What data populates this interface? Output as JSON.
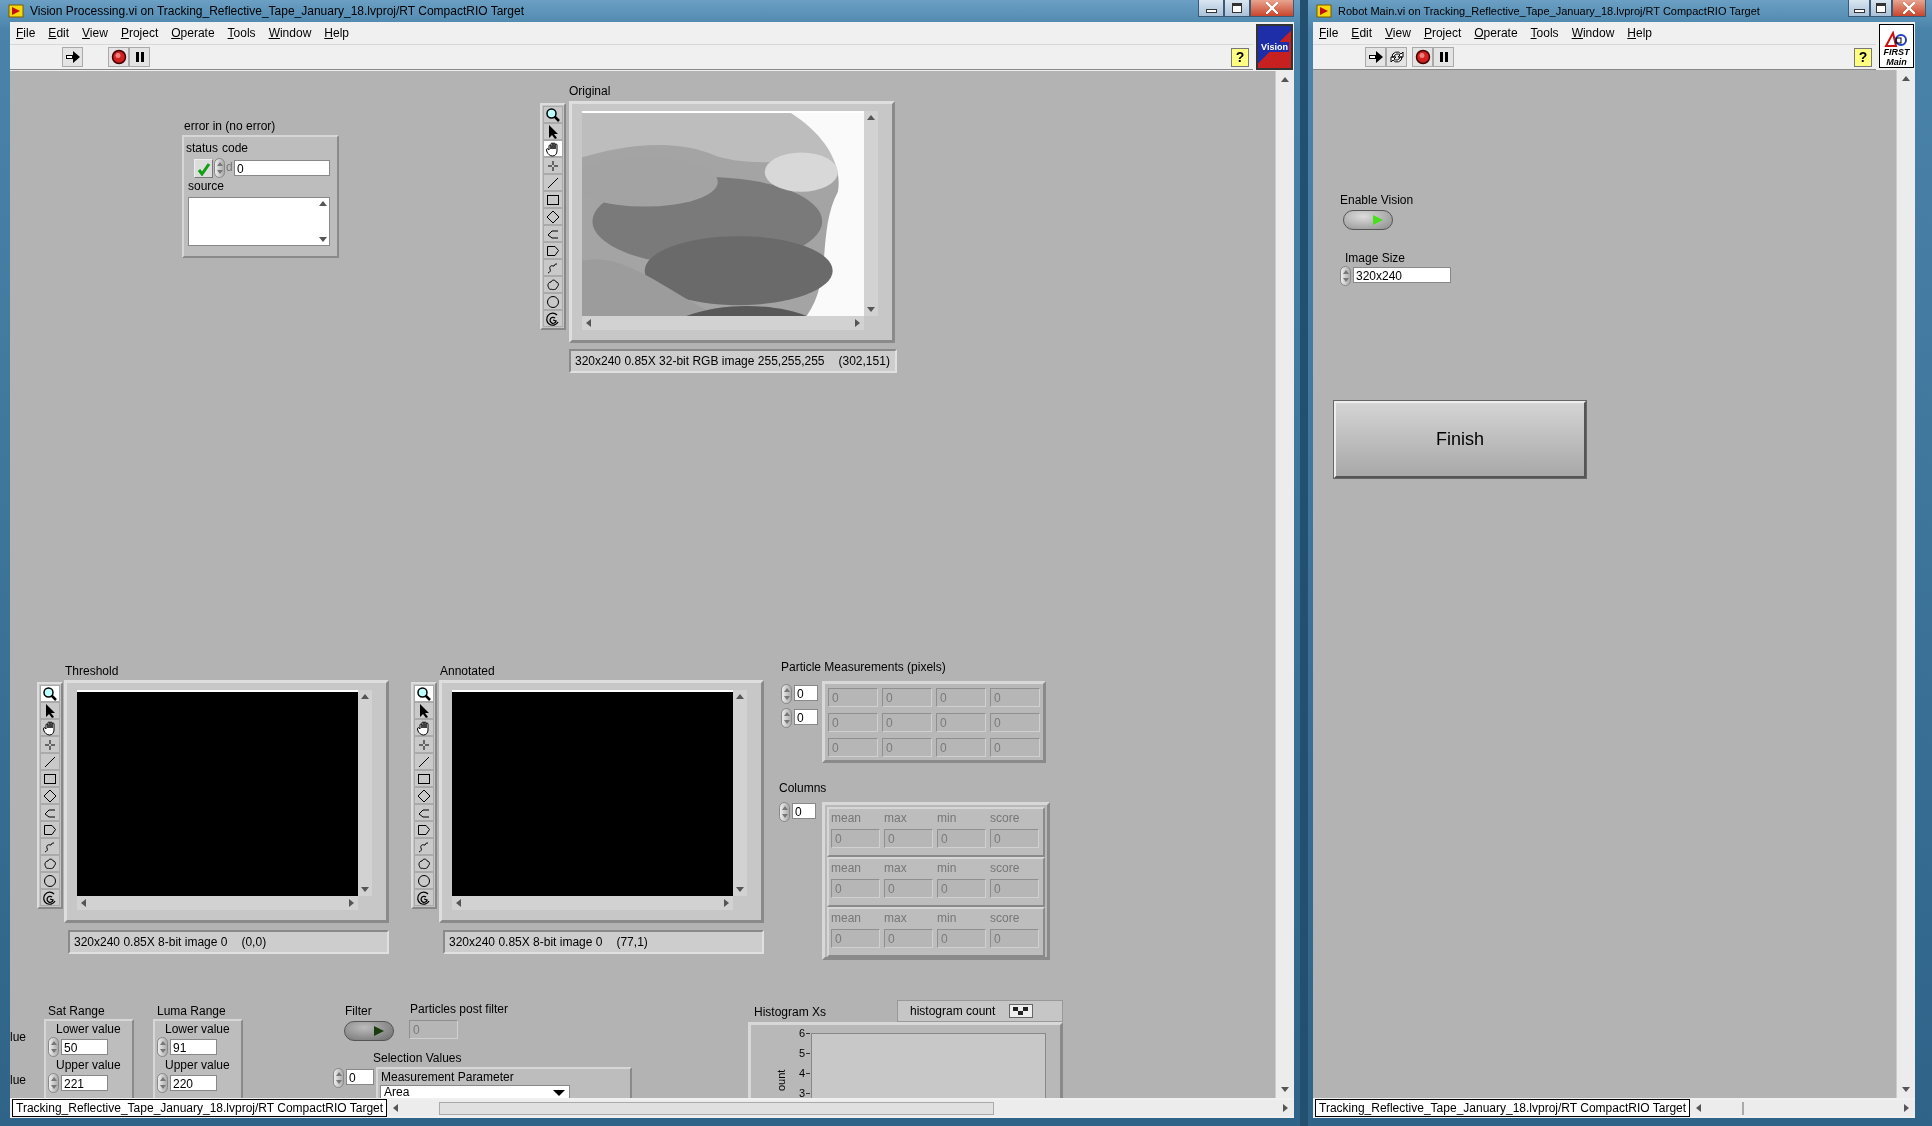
{
  "vision_window": {
    "title": "Vision Processing.vi on Tracking_Reflective_Tape_January_18.lvproj/RT CompactRIO Target",
    "menu": [
      "File",
      "Edit",
      "View",
      "Project",
      "Operate",
      "Tools",
      "Window",
      "Help"
    ],
    "toolbar": [
      {
        "kind": "run"
      },
      {
        "kind": "abort"
      },
      {
        "kind": "pause"
      }
    ],
    "help": "?",
    "vi_icon": [
      "Vision"
    ],
    "error_in": {
      "label": "error in (no error)",
      "status_label": "status",
      "status_ok": true,
      "code_label": "code",
      "radix": "d",
      "code": "0",
      "source_label": "source"
    },
    "image_displays": [
      {
        "label": "Original",
        "kind": "picture",
        "info": "320x240 0.85X 32-bit RGB image 255,255,255",
        "position": "(302,151)",
        "tools": [
          {
            "kind": "zoom",
            "selected": false
          },
          {
            "kind": "pointer",
            "selected": false
          },
          {
            "kind": "pan",
            "selected": true
          },
          {
            "kind": "point",
            "selected": false
          },
          {
            "kind": "line",
            "selected": false
          },
          {
            "kind": "rectangle",
            "selected": false
          },
          {
            "kind": "rotated_rectangle",
            "selected": false
          },
          {
            "kind": "broken_line",
            "selected": false
          },
          {
            "kind": "polygon",
            "selected": false
          },
          {
            "kind": "freehand_line",
            "selected": false
          },
          {
            "kind": "freehand",
            "selected": false
          },
          {
            "kind": "oval",
            "selected": false
          },
          {
            "kind": "annulus",
            "selected": false
          }
        ]
      },
      {
        "label": "Threshold",
        "kind": "empty",
        "info": "320x240 0.85X 8-bit image 0",
        "position": "(0,0)",
        "tools": [
          {
            "kind": "zoom",
            "selected": true
          },
          {
            "kind": "pointer",
            "selected": false
          },
          {
            "kind": "pan",
            "selected": false
          },
          {
            "kind": "point",
            "selected": false
          },
          {
            "kind": "line",
            "selected": false
          },
          {
            "kind": "rectangle",
            "selected": false
          },
          {
            "kind": "rotated_rectangle",
            "selected": false
          },
          {
            "kind": "broken_line",
            "selected": false
          },
          {
            "kind": "polygon",
            "selected": false
          },
          {
            "kind": "freehand_line",
            "selected": false
          },
          {
            "kind": "freehand",
            "selected": false
          },
          {
            "kind": "oval",
            "selected": false
          },
          {
            "kind": "annulus",
            "selected": false
          }
        ]
      },
      {
        "label": "Annotated",
        "kind": "empty",
        "info": "320x240 0.85X 8-bit image 0",
        "position": "(77,1)",
        "tools": [
          {
            "kind": "zoom",
            "selected": true
          },
          {
            "kind": "pointer",
            "selected": false
          },
          {
            "kind": "pan",
            "selected": false
          },
          {
            "kind": "point",
            "selected": false
          },
          {
            "kind": "line",
            "selected": false
          },
          {
            "kind": "rectangle",
            "selected": false
          },
          {
            "kind": "rotated_rectangle",
            "selected": false
          },
          {
            "kind": "broken_line",
            "selected": false
          },
          {
            "kind": "polygon",
            "selected": false
          },
          {
            "kind": "freehand_line",
            "selected": false
          },
          {
            "kind": "freehand",
            "selected": false
          },
          {
            "kind": "oval",
            "selected": false
          },
          {
            "kind": "annulus",
            "selected": false
          }
        ]
      }
    ],
    "particle_measurements": {
      "label": "Particle Measurements (pixels)",
      "indices": [
        "0",
        "0"
      ],
      "rows": [
        [
          "0",
          "0",
          "0",
          "0"
        ],
        [
          "0",
          "0",
          "0",
          "0"
        ],
        [
          "0",
          "0",
          "0",
          "0"
        ]
      ]
    },
    "columns": {
      "label": "Columns",
      "index": "0",
      "elements": [
        [
          {
            "label": "mean",
            "value": "0"
          },
          {
            "label": "max",
            "value": "0"
          },
          {
            "label": "min",
            "value": "0"
          },
          {
            "label": "score",
            "value": "0"
          }
        ],
        [
          {
            "label": "mean",
            "value": "0"
          },
          {
            "label": "max",
            "value": "0"
          },
          {
            "label": "min",
            "value": "0"
          },
          {
            "label": "score",
            "value": "0"
          }
        ],
        [
          {
            "label": "mean",
            "value": "0"
          },
          {
            "label": "max",
            "value": "0"
          },
          {
            "label": "min",
            "value": "0"
          },
          {
            "label": "score",
            "value": "0"
          }
        ]
      ]
    },
    "partial_range": {
      "lower_label": "lue",
      "upper_label": "lue"
    },
    "sat_range": {
      "label": "Sat Range",
      "lower_label": "Lower value",
      "lower": "50",
      "upper_label": "Upper value",
      "upper": "221"
    },
    "luma_range": {
      "label": "Luma Range",
      "lower_label": "Lower value",
      "lower": "91",
      "upper_label": "Upper value",
      "upper": "220"
    },
    "filter": {
      "label": "Filter",
      "on": false
    },
    "particles_post_filter": {
      "label": "Particles post filter",
      "value": "0"
    },
    "selection_values": {
      "label": "Selection Values",
      "index": "0",
      "parameter_label": "Measurement Parameter",
      "parameter": "Area"
    },
    "histogram": {
      "label": "Histogram Xs",
      "legend": "histogram count",
      "y_axis_label": "ount",
      "yticks": [
        "6",
        "5",
        "4",
        "3"
      ]
    },
    "status_bar": "Tracking_Reflective_Tape_January_18.lvproj/RT CompactRIO Target"
  },
  "robot_window": {
    "title": "Robot Main.vi on Tracking_Reflective_Tape_January_18.lvproj/RT CompactRIO Target",
    "menu": [
      "File",
      "Edit",
      "View",
      "Project",
      "Operate",
      "Tools",
      "Window",
      "Help"
    ],
    "toolbar": [
      {
        "kind": "run"
      },
      {
        "kind": "run_continuously"
      },
      {
        "kind": "abort"
      },
      {
        "kind": "pause"
      }
    ],
    "help": "?",
    "vi_icon": [
      "FIRST",
      "Main"
    ],
    "enable_vision": {
      "label": "Enable Vision",
      "on": true
    },
    "image_size": {
      "label": "Image Size",
      "value": "320x240"
    },
    "finish": "Finish",
    "status_bar": "Tracking_Reflective_Tape_January_18.lvproj/RT CompactRIO Target"
  }
}
